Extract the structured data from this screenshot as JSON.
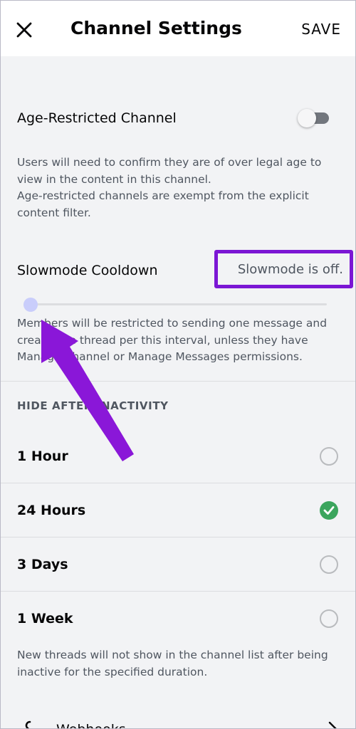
{
  "header": {
    "title": "Channel Settings",
    "save_label": "SAVE"
  },
  "age_restricted": {
    "label": "Age-Restricted Channel",
    "enabled": false,
    "description_1": "Users will need to confirm they are of over legal age to view in the content in this channel.",
    "description_2": "Age-restricted channels are exempt from the explicit content filter."
  },
  "slowmode": {
    "label": "Slowmode Cooldown",
    "value_text": "Slowmode is off.",
    "slider_level": 0,
    "description": "Members will be restricted to sending one message and create one thread per this interval, unless they have Manage Channel or Manage Messages permissions."
  },
  "hide_after_inactivity": {
    "header": "HIDE AFTER INACTIVITY",
    "options": [
      {
        "label": "1 Hour",
        "selected": false
      },
      {
        "label": "24 Hours",
        "selected": true
      },
      {
        "label": "3 Days",
        "selected": false
      },
      {
        "label": "1 Week",
        "selected": false
      }
    ],
    "description": "New threads will not show in the channel list after being inactive for the specified duration."
  },
  "webhooks": {
    "label": "Webhooks",
    "icon": "webhook-icon"
  },
  "colors": {
    "highlight": "#7b16d4",
    "arrow": "#8a17d8",
    "check": "#3ba55d",
    "slider": "#c9cdfb"
  }
}
